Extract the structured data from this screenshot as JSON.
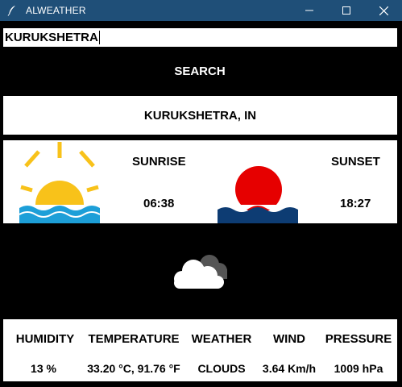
{
  "window": {
    "title": "ALWEATHER"
  },
  "search": {
    "value": "KURUKSHETRA",
    "button_label": "SEARCH"
  },
  "location": {
    "label": "KURUKSHETRA, IN"
  },
  "sun": {
    "sunrise_label": "SUNRISE",
    "sunrise_time": "06:38",
    "sunset_label": "SUNSET",
    "sunset_time": "18:27"
  },
  "current": {
    "icon": "partly-cloudy-icon"
  },
  "stats": {
    "humidity_label": "HUMIDITY",
    "humidity_value": "13 %",
    "temperature_label": "TEMPERATURE",
    "temperature_value": "33.20 °C, 91.76 °F",
    "weather_label": "WEATHER",
    "weather_value": "CLOUDS",
    "wind_label": "WIND",
    "wind_value": "3.64 Km/h",
    "pressure_label": "PRESSURE",
    "pressure_value": "1009 hPa"
  },
  "colors": {
    "titlebar": "#1f4f78",
    "background": "#000000",
    "sun_yellow": "#f8c21a",
    "sea_blue": "#1d9fd8",
    "sunset_red": "#e60000",
    "sunset_sea": "#0d3c73"
  }
}
